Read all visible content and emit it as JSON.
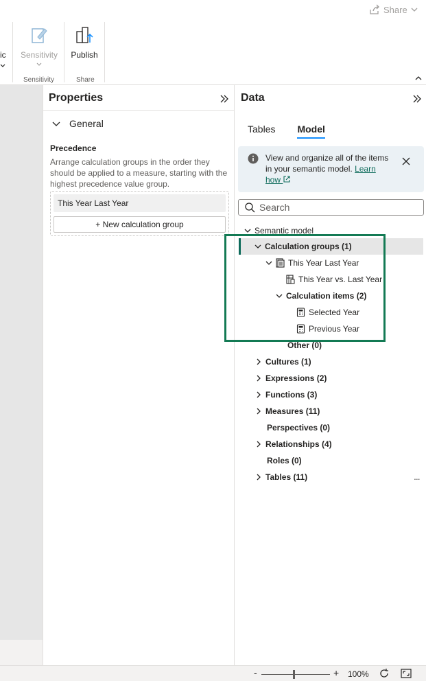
{
  "topbar": {
    "share_label": "Share"
  },
  "ribbon": {
    "cut_label": "ic",
    "sensitivity_label": "Sensitivity",
    "sensitivity_group_label": "Sensitivity",
    "publish_label": "Publish",
    "share_group_label": "Share"
  },
  "properties": {
    "title": "Properties",
    "section_label": "General",
    "precedence_title": "Precedence",
    "precedence_desc": "Arrange calculation groups in the order they should be applied to a measure, starting with the highest precedence value group.",
    "calc_groups": [
      "This Year Last Year"
    ],
    "new_calc_group_label": "+ New calculation group"
  },
  "data": {
    "title": "Data",
    "tabs": [
      "Tables",
      "Model"
    ],
    "active_tab": "Model",
    "info_text": "View and organize all of the items in your semantic model.",
    "info_link": "Learn how",
    "search_placeholder": "Search",
    "tree": {
      "root": "Semantic model",
      "calc_groups": "Calculation groups (1)",
      "this_year_last_year": "This Year Last Year",
      "this_year_vs": "This Year vs. Last Year",
      "calc_items": "Calculation items (2)",
      "selected_year": "Selected Year",
      "previous_year": "Previous Year",
      "other": "Other (0)",
      "cultures": "Cultures (1)",
      "expressions": "Expressions (2)",
      "functions": "Functions (3)",
      "measures": "Measures (11)",
      "perspectives": "Perspectives (0)",
      "relationships": "Relationships (4)",
      "roles": "Roles (0)",
      "tables": "Tables (11)"
    },
    "more_label": "..."
  },
  "status": {
    "zoom_minus": "-",
    "zoom_plus": "+",
    "zoom_value": "100%",
    "zoom_level": 0.47
  },
  "colors": {
    "accent": "#0e6b5b",
    "highlight": "#137a54",
    "tab_underline": "#118dff"
  }
}
